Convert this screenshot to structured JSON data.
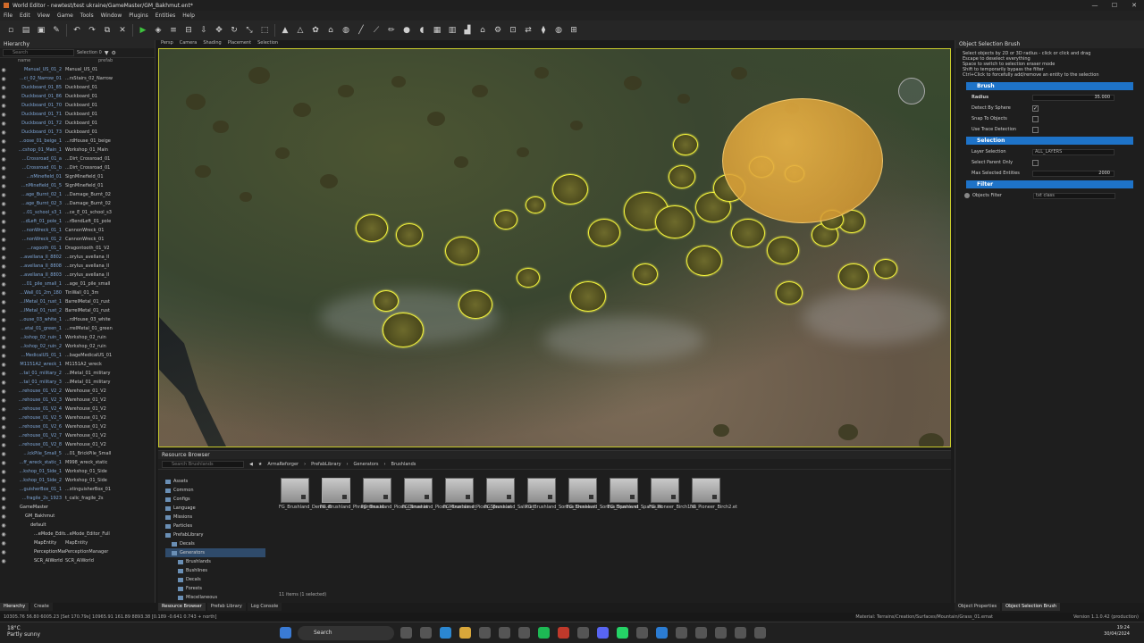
{
  "window": {
    "title": "World Editor - newtest/test ukraine/GameMaster/GM_Bakhmut.ent*",
    "controls": [
      "—",
      "☐",
      "✕"
    ]
  },
  "menu": [
    "File",
    "Edit",
    "View",
    "Game",
    "Tools",
    "Window",
    "Plugins",
    "Entities",
    "Help"
  ],
  "viewport_tabs": [
    "Persp",
    "Camera",
    "Shading",
    "Placement",
    "Selection"
  ],
  "hierarchy": {
    "title": "Hierarchy",
    "search_placeholder": "Search",
    "selection": "Selection 0",
    "col_name": "name",
    "col_prefab": "prefab",
    "rows": [
      [
        "Manual_US_01_2",
        "Manual_US_01"
      ],
      [
        "...ci_02_Narrow_01",
        "...rsStairs_02_Narrow"
      ],
      [
        "Duckboard_01_85",
        "Duckboard_01"
      ],
      [
        "Duckboard_01_86",
        "Duckboard_01"
      ],
      [
        "Duckboard_01_70",
        "Duckboard_01"
      ],
      [
        "Duckboard_01_71",
        "Duckboard_01"
      ],
      [
        "Duckboard_01_72",
        "Duckboard_01"
      ],
      [
        "Duckboard_01_73",
        "Duckboard_01"
      ],
      [
        "...oose_01_beige_1",
        "...rdHouse_01_beige"
      ],
      [
        "...cshop_01_Main_1",
        "Workshop_01_Main"
      ],
      [
        "...Crossroad_01_a",
        "...Dirt_Crossroad_01"
      ],
      [
        "...Crossroad_01_b",
        "...Dirt_Crossroad_01"
      ],
      [
        "...nMinefield_01",
        "SignMinefield_01"
      ],
      [
        "...nMinefield_01_5",
        "SignMinefield_01"
      ],
      [
        "...age_Burnt_02_1",
        "...Damage_Burnt_02"
      ],
      [
        "...age_Burnt_02_3",
        "...Damage_Burnt_02"
      ],
      [
        "...01_school_s3_1",
        "...ce_E_01_school_s3"
      ],
      [
        "...dLeft_01_pole_1",
        "...rBendLeft_01_pole"
      ],
      [
        "...nonWreck_01_1",
        "CannonWreck_01"
      ],
      [
        "...nonWreck_01_2",
        "CannonWreck_01"
      ],
      [
        "...ragooth_01_1",
        "Dragontooth_01_V2"
      ],
      [
        "...avellana_II_8802",
        "...orylus_avellana_II"
      ],
      [
        "...avellana_II_8808",
        "...orylus_avellana_II"
      ],
      [
        "...avellana_II_8803",
        "...orylus_avellana_II"
      ],
      [
        "...01_pile_small_1",
        "...age_01_pile_small"
      ],
      [
        "...Wall_01_2m_180",
        "TinWall_01_3m"
      ],
      [
        "...lMetal_01_rust_1",
        "BarrelMetal_01_rust"
      ],
      [
        "...lMetal_01_rust_2",
        "BarrelMetal_01_rust"
      ],
      [
        "...ouse_03_white_1",
        "...rdHouse_03_white"
      ],
      [
        "...etal_01_green_1",
        "...rrelMetal_01_green"
      ],
      [
        "...kshop_02_ruin_1",
        "Workshop_02_ruin"
      ],
      [
        "...kshop_02_ruin_2",
        "Workshop_02_ruin"
      ],
      [
        "...MedicalUS_01_1",
        "...bageMedicalUS_01"
      ],
      [
        "M1151A2_wreck_1",
        "M1151A2_wreck"
      ],
      [
        "...tal_01_military_2",
        "...lMetal_01_military"
      ],
      [
        "...tal_01_military_3",
        "...lMetal_01_military"
      ],
      [
        "...rehouse_01_V2_2",
        "Warehouse_01_V2"
      ],
      [
        "...rehouse_01_V2_3",
        "Warehouse_01_V2"
      ],
      [
        "...rehouse_01_V2_4",
        "Warehouse_01_V2"
      ],
      [
        "...rehouse_01_V2_5",
        "Warehouse_01_V2"
      ],
      [
        "...rehouse_01_V2_6",
        "Warehouse_01_V2"
      ],
      [
        "...rehouse_01_V2_7",
        "Warehouse_01_V2"
      ],
      [
        "...rehouse_01_V2_8",
        "Warehouse_01_V2"
      ],
      [
        "...ickPile_Small_5",
        "...01_BrickPile_Small"
      ],
      [
        "...ff_wreck_static_1",
        "M998_wreck_static"
      ],
      [
        "...kshop_01_Side_1",
        "Workshop_01_Side"
      ],
      [
        "...kshop_01_Side_2",
        "Workshop_01_Side"
      ],
      [
        "...guisherBox_01_1",
        "...xtinguisherBox_01"
      ],
      [
        "...fragile_2s_1923",
        "t_calic_fragile_2s"
      ]
    ],
    "entities": [
      {
        "name": "GameMaster",
        "prefab": ""
      },
      {
        "name": "GM_Bakhmut",
        "prefab": ""
      },
      {
        "name": "default",
        "prefab": ""
      },
      {
        "name": "...eMode_Editor_Full",
        "prefab": "...eMode_Editor_Full"
      },
      {
        "name": "MapEntity",
        "prefab": "MapEntity"
      },
      {
        "name": "PerceptionManager",
        "prefab": "PerceptionManager"
      },
      {
        "name": "SCR_AIWorld",
        "prefab": "SCR_AIWorld"
      }
    ],
    "tabs": [
      "Hierarchy",
      "Create"
    ]
  },
  "object_brush": {
    "title": "Object Selection Brush",
    "help": [
      "Select objects by 2D or 3D radius - click or click and drag",
      "Escape to deselect everything",
      "Space to switch to selection eraser mode",
      "Shift to temporarily bypass the filter",
      "Ctrl+Click to forcefully add/remove an entity to the selection"
    ],
    "brush": {
      "header": "Brush",
      "radius_label": "Radius",
      "radius_value": "35.000",
      "detect_sphere_label": "Detect By Sphere",
      "detect_sphere_checked": "✓",
      "snap_label": "Snap To Objects",
      "trace_label": "Use Trace Detection"
    },
    "selection": {
      "header": "Selection",
      "layer_label": "Layer Selection",
      "layer_value": "ALL_LAYERS",
      "parent_only_label": "Select Parent Only",
      "max_label": "Max Selected Entities",
      "max_value": "2000"
    },
    "filter": {
      "header": "Filter",
      "objects_filter_label": "Objects Filter",
      "objects_filter_value": "txt class"
    },
    "tabs": [
      "Object Properties",
      "Object Selection Brush"
    ]
  },
  "resource_browser": {
    "title": "Resource Browser",
    "search_placeholder": "Search Brushlands",
    "breadcrumb": [
      "ArmaReforger",
      "PrefabLibrary",
      "Generators",
      "Brushlands"
    ],
    "folders": [
      "Assets",
      "Common",
      "Configs",
      "Language",
      "Missions",
      "Particles",
      "PrefabLibrary",
      "Decals",
      "Generators",
      "Brushlands",
      "Bushlines",
      "Decals",
      "Forests",
      "Miscellaneous"
    ],
    "assets": [
      {
        "name": "FG_Brushland_Dense.et"
      },
      {
        "name": "FG_Brushland_Phragmites.et"
      },
      {
        "name": "FG_Brushland_Picea_Dense.et"
      },
      {
        "name": "FG_Brushland_Picea_Mountain.et"
      },
      {
        "name": "FG_Brushland_Picea_Sparse.et"
      },
      {
        "name": "FG_Brushland_Salix.et"
      },
      {
        "name": "FG_Brushland_Sorbus_Dense.et"
      },
      {
        "name": "FG_Brushland_Sorbus_Sparse.et"
      },
      {
        "name": "FG_Brushland_Sparse.et"
      },
      {
        "name": "FG_Pioneer_Birch1.et"
      },
      {
        "name": "FG_Pioneer_Birch2.et"
      }
    ],
    "status": "11 items (1 selected)",
    "tabs": [
      "Resource Browser",
      "Prefab Library",
      "Log Console"
    ]
  },
  "statusbar": {
    "coords": "10305.76   56.80   6005.23 [Set 170.79s]       10965.91   161.89   8893.38 [0.189 -0.641  0.743 + north]",
    "material": "Material: Terrains/Creation/Surfaces/Mountain/Grass_01.emat",
    "version": "Version 1.1.0.42 (production)"
  },
  "taskbar": {
    "temp": "18°C",
    "weather": "Partly sunny",
    "search": "Search",
    "time": "19:24",
    "date": "30/04/2024"
  }
}
